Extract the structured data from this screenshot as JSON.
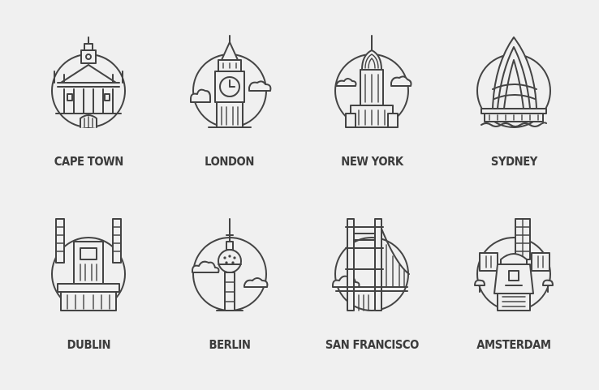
{
  "colors": {
    "background": "#f0f0f0",
    "stroke": "#444444",
    "text": "#3c3c3c"
  },
  "cities": [
    {
      "label": "CAPE TOWN",
      "icon": "cape-town-city-hall-icon"
    },
    {
      "label": "LONDON",
      "icon": "big-ben-icon"
    },
    {
      "label": "NEW YORK",
      "icon": "chrysler-building-icon"
    },
    {
      "label": "SYDNEY",
      "icon": "sydney-opera-house-icon"
    },
    {
      "label": "DUBLIN",
      "icon": "dublin-building-icon"
    },
    {
      "label": "BERLIN",
      "icon": "berlin-tv-tower-icon"
    },
    {
      "label": "SAN FRANCISCO",
      "icon": "golden-gate-bridge-icon"
    },
    {
      "label": "AMSTERDAM",
      "icon": "amsterdam-windmill-icon"
    }
  ]
}
